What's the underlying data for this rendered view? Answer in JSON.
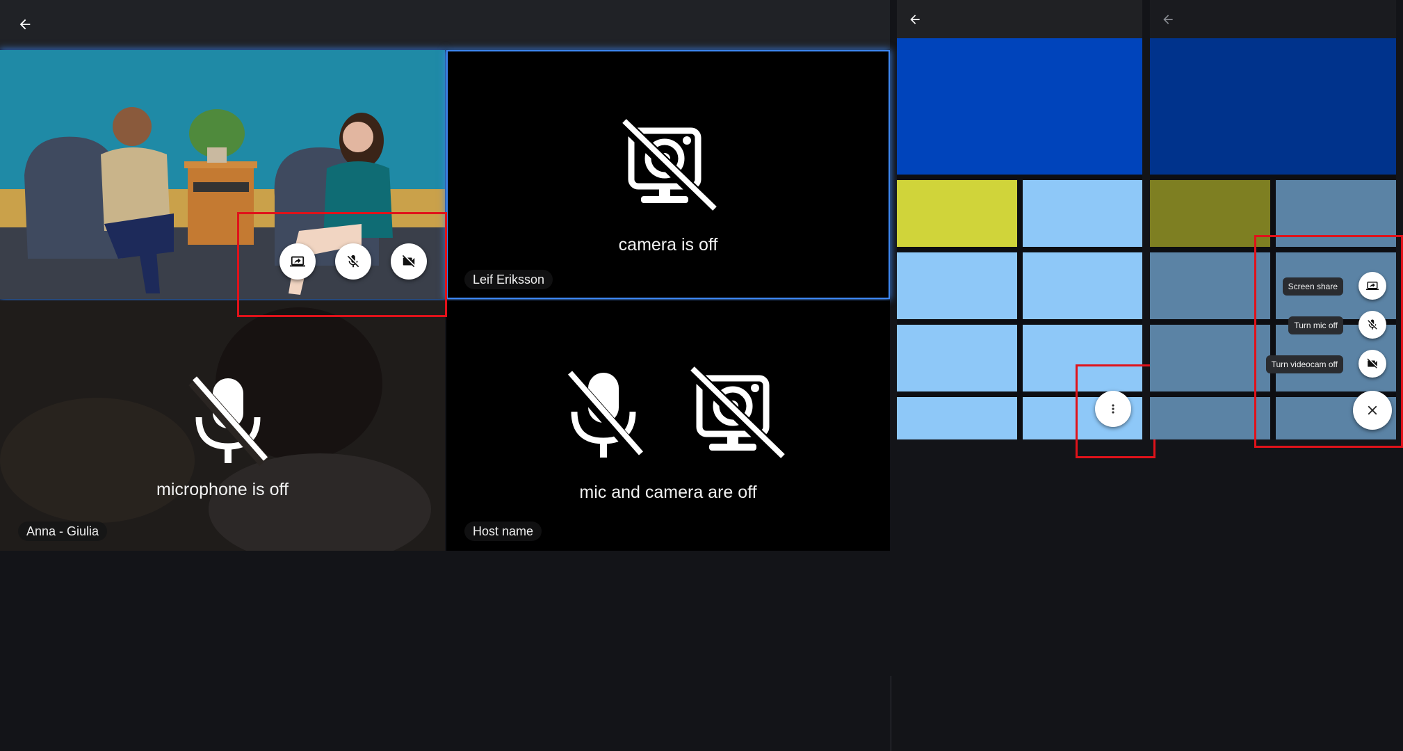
{
  "left": {
    "tiles": [
      {
        "name": "",
        "status": "",
        "overlay_buttons": [
          "screen-share-icon",
          "mic-off-icon",
          "videocam-off-icon"
        ]
      },
      {
        "name": "Leif Eriksson",
        "status": "camera is off"
      },
      {
        "name": "Anna - Giulia",
        "status": "microphone is off"
      },
      {
        "name": "Host name",
        "status": "mic and camera are off"
      }
    ]
  },
  "right": {
    "speed_dial": {
      "items": [
        {
          "label": "Screen share",
          "icon": "screen-share-icon"
        },
        {
          "label": "Turn mic off",
          "icon": "mic-off-icon"
        },
        {
          "label": "Turn videocam off",
          "icon": "videocam-off-icon"
        }
      ],
      "close_icon": "close-icon",
      "more_icon": "more-vert-icon"
    }
  },
  "colors": {
    "highlight_red": "#e0121a",
    "selected_blue": "#3d86f0",
    "dark_blue": "#0044bb",
    "lime": "#d0d43a",
    "light_blue": "#8ec8f8"
  }
}
